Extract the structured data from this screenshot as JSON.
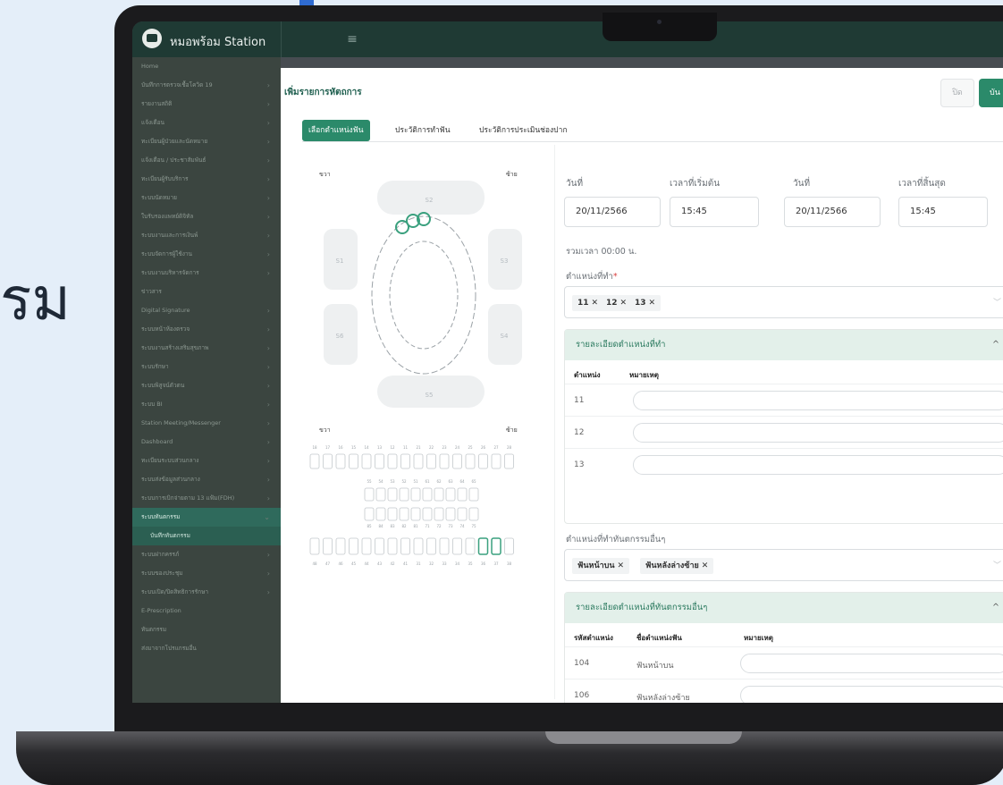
{
  "hero_text": "รม",
  "app": {
    "brand": "หมอพร้อม Station"
  },
  "sidebar": {
    "items": [
      {
        "label": "Home",
        "chev": false
      },
      {
        "label": "บันทึกการตรวจเชื้อโควิด 19",
        "chev": true
      },
      {
        "label": "รายงานสถิติ",
        "chev": true
      },
      {
        "label": "แจ้งเตือน",
        "chev": true
      },
      {
        "label": "ทะเบียนผู้ป่วยและนัดหมาย",
        "chev": true
      },
      {
        "label": "แจ้งเตือน / ประชาสัมพันธ์",
        "chev": true
      },
      {
        "label": "ทะเบียนผู้รับบริการ",
        "chev": true
      },
      {
        "label": "ระบบนัดหมาย",
        "chev": true
      },
      {
        "label": "ใบรับรองแพทย์ดิจิทัล",
        "chev": true
      },
      {
        "label": "ระบบงานและการเงินพ์",
        "chev": true
      },
      {
        "label": "ระบบจัดการผู้ใช้งาน",
        "chev": true
      },
      {
        "label": "ระบบงานบริหารจัดการ",
        "chev": true
      },
      {
        "label": "ข่าวสาร",
        "chev": false
      },
      {
        "label": "Digital Signature",
        "chev": true
      },
      {
        "label": "ระบบหน้าห้องตรวจ",
        "chev": true
      },
      {
        "label": "ระบบงานสร้างเสริมสุขภาพ",
        "chev": true
      },
      {
        "label": "ระบบรักษา",
        "chev": true
      },
      {
        "label": "ระบบพิสูจน์ตัวตน",
        "chev": true
      },
      {
        "label": "ระบบ BI",
        "chev": true
      },
      {
        "label": "Station Meeting/Messenger",
        "chev": true
      },
      {
        "label": "Dashboard",
        "chev": true
      },
      {
        "label": "ทะเบียนระบบส่วนกลาง",
        "chev": true
      },
      {
        "label": "ระบบส่งข้อมูลส่วนกลาง",
        "chev": true
      },
      {
        "label": "ระบบการเบิกจ่ายตาม 13 แฟ้ม(FDH)",
        "chev": true
      },
      {
        "label": "ระบบทันตกรรม",
        "chev": true,
        "active": true
      },
      {
        "label": "บันทึกทันตกรรม",
        "chev": false,
        "sub": true
      },
      {
        "label": "ระบบฝากครรภ์",
        "chev": true
      },
      {
        "label": "ระบบของประชุม",
        "chev": true
      },
      {
        "label": "ระบบเปิด/ปิดสิทธิการรักษา",
        "chev": true
      },
      {
        "label": "E-Prescription",
        "chev": false
      },
      {
        "label": "ทันตกรรม",
        "chev": false
      },
      {
        "label": "ส่งมาจากโปรแกรมอื่น",
        "chev": false
      }
    ]
  },
  "modal": {
    "title": "เพิ่มรายการหัตถการ",
    "close_label": "ปิด",
    "save_label": "บัน",
    "tabs": [
      "เลือกตำแหน่งฟัน",
      "ประวัติการทำฟัน",
      "ประวัติการประเมินช่องปาก"
    ]
  },
  "tooth_chart": {
    "right_label": "ขวา",
    "left_label": "ซ้าย",
    "right_label_2": "ขวา",
    "left_label_2": "ซ้าย",
    "sextants": [
      "S1",
      "S2",
      "S3",
      "S4",
      "S5",
      "S6"
    ],
    "upper_row_numbers": [
      "18",
      "17",
      "16",
      "15",
      "14",
      "13",
      "12",
      "11",
      "21",
      "22",
      "23",
      "24",
      "25",
      "26",
      "27",
      "28"
    ],
    "primary_upper_numbers": [
      "55",
      "54",
      "53",
      "52",
      "51",
      "61",
      "62",
      "63",
      "64",
      "65"
    ],
    "primary_lower_numbers": [
      "85",
      "84",
      "83",
      "82",
      "81",
      "71",
      "72",
      "73",
      "74",
      "75"
    ],
    "lower_row_numbers": [
      "48",
      "47",
      "46",
      "45",
      "44",
      "43",
      "42",
      "41",
      "31",
      "32",
      "33",
      "34",
      "35",
      "36",
      "37",
      "38"
    ],
    "accent_color": "#3aa07e",
    "selected_teeth": [
      "11",
      "12",
      "13"
    ]
  },
  "form": {
    "start_date_label": "วันที่",
    "start_time_label": "เวลาที่เริ่มต้น",
    "end_date_label": "วันที่",
    "end_time_label": "เวลาที่สิ้นสุด",
    "start_date": "20/11/2566",
    "start_time": "15:45",
    "end_date": "20/11/2566",
    "end_time": "15:45",
    "total_time": "รวมเวลา 00:00 น.",
    "position_label": "ตำแหน่งที่ทำ",
    "position_tags": [
      "11",
      "12",
      "13"
    ],
    "detail_panel_title": "รายละเอียดตำแหน่งที่ทำ",
    "detail_headers": {
      "position": "ตำแหน่ง",
      "note": "หมายเหตุ"
    },
    "detail_rows": [
      "11",
      "12",
      "13"
    ],
    "other_label": "ตำแหน่งที่ทำทันตกรรมอื่นๆ",
    "other_tags": [
      "ฟันหน้าบน",
      "ฟันหลังล่างซ้าย"
    ],
    "other_panel_title": "รายละเอียดตำแหน่งที่ทันตกรรมอื่นๆ",
    "other_headers": {
      "code": "รหัสตำแหน่ง",
      "name": "ชื่อตำแหน่งฟัน",
      "note": "หมายเหตุ"
    },
    "other_rows": [
      {
        "code": "104",
        "name": "ฟันหน้าบน"
      },
      {
        "code": "106",
        "name": "ฟันหลังล่างซ้าย"
      }
    ]
  }
}
